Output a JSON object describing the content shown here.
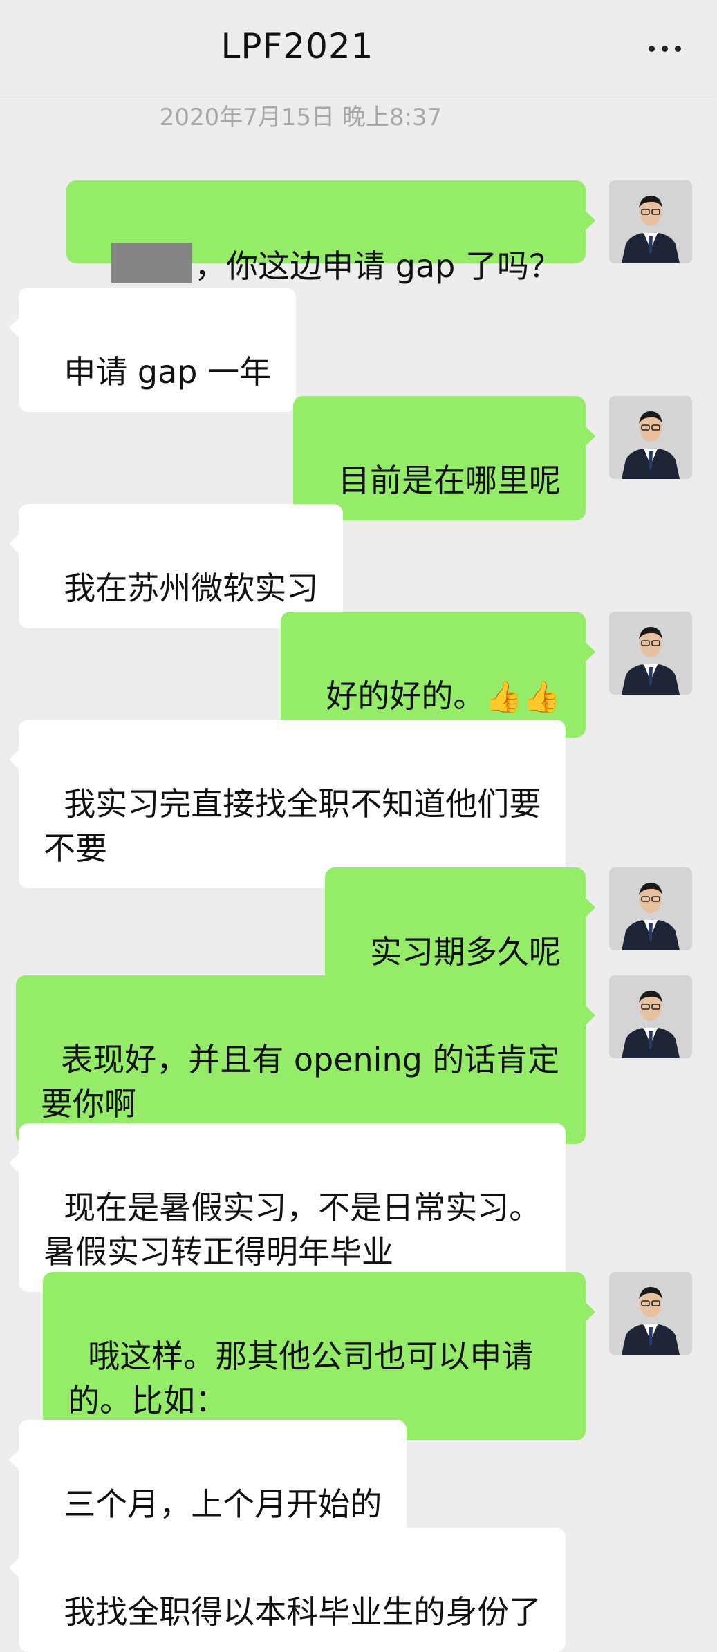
{
  "header": {
    "title": "LPF2021",
    "more_icon": "more-icon"
  },
  "timestamp": "2020年7月15日 晚上8:37",
  "messages": [
    {
      "text": "，你这边申请 gap 了吗？"
    },
    {
      "text": "申请 gap 一年"
    },
    {
      "text": "目前是在哪里呢"
    },
    {
      "text": "我在苏州微软实习"
    },
    {
      "text": "好的好的。",
      "emoji": "👍👍"
    },
    {
      "text": "我实习完直接找全职不知道他们要\n不要"
    },
    {
      "text": "实习期多久呢"
    },
    {
      "text": "表现好，并且有 opening 的话肯定\n要你啊"
    },
    {
      "text": "现在是暑假实习，不是日常实习。\n暑假实习转正得明年毕业"
    },
    {
      "text": "哦这样。那其他公司也可以申请\n的。比如："
    },
    {
      "text": "三个月，上个月开始的"
    },
    {
      "text": "我找全职得以本科毕业生的身份了"
    }
  ],
  "colors": {
    "outgoing": "#95ec69",
    "incoming": "#ffffff",
    "background": "#ededed"
  }
}
